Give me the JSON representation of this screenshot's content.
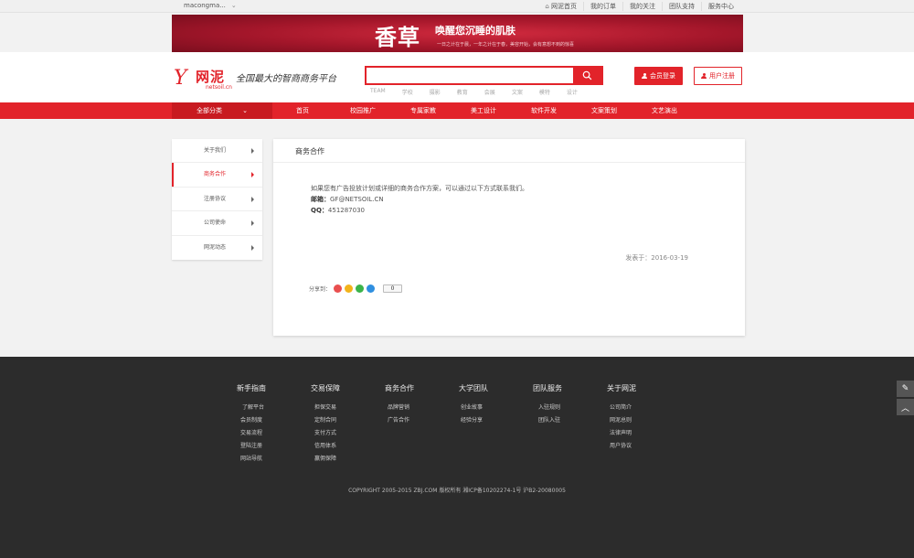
{
  "topbar": {
    "user": "macongma...",
    "links": [
      "网泥首页",
      "我的订单",
      "我的关注",
      "团队支持",
      "服务中心"
    ]
  },
  "banner": {
    "big": "香草",
    "slogan": "唤醒您沉睡的肌肤",
    "small": "一日之计在于晨，一年之计在于春，美容开始，会有意想不到的惊喜"
  },
  "header": {
    "logo_mark": "Y",
    "logo_name": "网泥",
    "logo_url": "netsoil.cn",
    "tagline": "全国最大的智商商务平台",
    "search_placeholder": "",
    "hotwords": [
      "TEAM",
      "学校",
      "摄影",
      "教育",
      "会展",
      "文案",
      "模特",
      "设计"
    ],
    "login_label": "会员登录",
    "register_label": "用户注册"
  },
  "nav": {
    "all_label": "全部分类",
    "items": [
      "首页",
      "校园推广",
      "专属家教",
      "美工设计",
      "软件开发",
      "文案策划",
      "文艺演出"
    ]
  },
  "sidebar": {
    "items": [
      "关于我们",
      "商务合作",
      "注册协议",
      "公司使命",
      "网泥动态"
    ],
    "active_index": 1
  },
  "content": {
    "title": "商务合作",
    "intro": "如果您有广告投放计划或详细的商务合作方案，可以通过以下方式联系我们。",
    "email_label": "邮箱：",
    "email_value": "GF@NETSOIL.CN",
    "qq_label": "QQ：",
    "qq_value": "451287030",
    "date": "发表于：2016-03-19",
    "share_label": "分享到：",
    "share_count": "0",
    "share_colors": [
      "#e94f4f",
      "#f2b31b",
      "#3bb34a",
      "#2f8fe0"
    ]
  },
  "footer": {
    "columns": [
      {
        "title": "新手指南",
        "links": [
          "了解平台",
          "会员制度",
          "交易流程",
          "登陆注册",
          "网站导航"
        ]
      },
      {
        "title": "交易保障",
        "links": [
          "担保交易",
          "定制合同",
          "支付方式",
          "信用体系",
          "赢佣保障"
        ]
      },
      {
        "title": "商务合作",
        "links": [
          "品牌营销",
          "广告合作"
        ]
      },
      {
        "title": "大学团队",
        "links": [
          "创业故事",
          "经验分享"
        ]
      },
      {
        "title": "团队服务",
        "links": [
          "入驻规则",
          "团队入驻"
        ]
      },
      {
        "title": "关于网泥",
        "links": [
          "公司简介",
          "网泥总则",
          "法律声明",
          "用户协议"
        ]
      }
    ],
    "copyright": "COPYRIGHT 2005-2015 ZBJ.COM 版权所有 湘ICP备10202274-1号 沪B2-20080005"
  },
  "float_buttons": [
    "✎",
    "︿"
  ],
  "colors": {
    "brand_red": "#e2232a",
    "footer_bg": "#2c2c2c"
  }
}
